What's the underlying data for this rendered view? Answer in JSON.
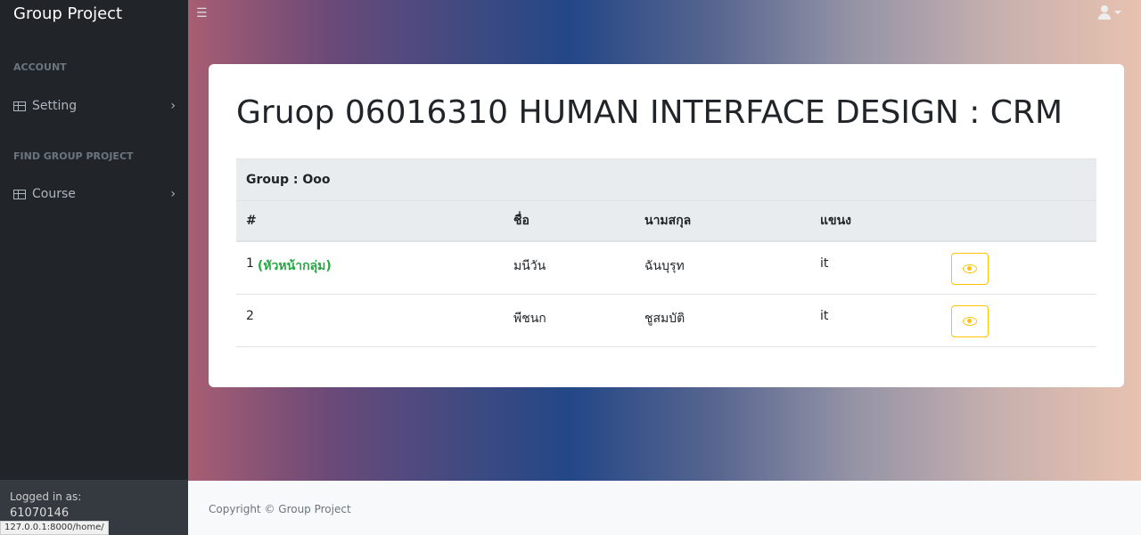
{
  "sidebar": {
    "brand": "Group Project",
    "sections": [
      {
        "heading": "ACCOUNT",
        "item": {
          "label": "Setting",
          "icon": "table-icon"
        }
      },
      {
        "heading": "FIND GROUP PROJECT",
        "item": {
          "label": "Course",
          "icon": "table-icon"
        }
      }
    ],
    "footer_label": "Logged in as:",
    "footer_user": "61070146"
  },
  "topbar": {
    "menu_icon": "hamburger-icon",
    "user_icon": "user-icon"
  },
  "card": {
    "title": "Gruop 06016310 HUMAN INTERFACE DESIGN : CRM",
    "group_label": "Group : Ooo",
    "columns": [
      "#",
      "ชื่อ",
      "นามสกุล",
      "แขนง"
    ],
    "rows": [
      {
        "num": "1",
        "tag": "(หัวหน้ากลุ่ม)",
        "first": "มนีวัน",
        "last": "ฉันบุรุท",
        "branch": "it"
      },
      {
        "num": "2",
        "tag": "",
        "first": "พีชนก",
        "last": "ชูสมบัติ",
        "branch": "it"
      }
    ],
    "accent": "#ffc107",
    "leader_color": "#28a745"
  },
  "footer": {
    "copyright": "Copyright © Group Project"
  },
  "status_url": "127.0.0.1:8000/home/"
}
